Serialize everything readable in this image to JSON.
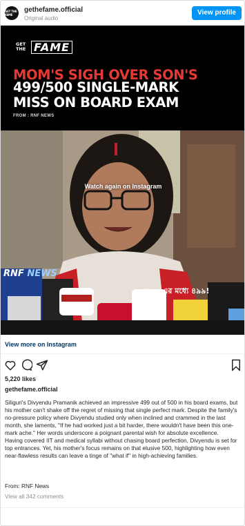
{
  "header": {
    "avatar_text": "GET THE FAME",
    "account": "gethefame.official",
    "audio": "Original audio",
    "view_profile": "View profile"
  },
  "media": {
    "logo_get_the": "GET THE",
    "logo_fame": "FAME",
    "headline_line1": "MOM'S SIGH OVER SON'S",
    "headline_line2": "499/500 SINGLE-MARK",
    "headline_line3": "MISS ON BOARD EXAM",
    "source": "FROM : RNF NEWS",
    "watch_again": "Watch again on Instagram",
    "channel_label_rnf": "RNF",
    "channel_label_news": "NEWS",
    "onscreen_caption": "৫০০-এর মধ্যে ৪৯৯!"
  },
  "actions": {
    "view_more": "View more on Instagram",
    "heart_icon": "heart-icon",
    "comment_icon": "comment-icon",
    "share_icon": "share-icon",
    "bookmark_icon": "bookmark-icon"
  },
  "post": {
    "likes": "5,220 likes",
    "caption_account": "gethefame.official",
    "paragraph1": "Siliguri's Divyendu Pramanik achieved an impressive 499 out of 500 in his board exams, but his mother can't shake off the regret of missing that single perfect mark. Despite the family's no-pressure policy where Divyendu studied only when inclined and crammed in the last month, she laments, \"If he had worked just a bit harder, there wouldn't have been this one-mark ache.\" Her words underscore a poignant parental wish for absolute excellence.",
    "paragraph2": "Having covered IIT and medical syllabi without chasing board perfection, Divyendu is set for top entrances. Yet, his mother's focus remains on that elusive 500, highlighting how even near-flawless results can leave a tinge of \"what if\" in high-achieving families.",
    "from": "From: RNF News",
    "view_all_comments": "View all 342 comments"
  },
  "colors": {
    "accent_blue": "#0095f6",
    "link_blue": "#00376b",
    "headline_red": "#e53935",
    "muted": "#8e8e8e"
  }
}
